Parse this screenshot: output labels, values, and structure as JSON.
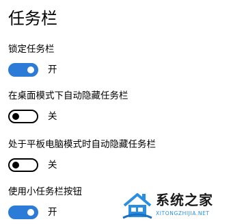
{
  "page": {
    "title": "任务栏"
  },
  "settings": [
    {
      "label": "锁定任务栏",
      "state": "on",
      "state_label": "开"
    },
    {
      "label": "在桌面模式下自动隐藏任务栏",
      "state": "off",
      "state_label": "关"
    },
    {
      "label": "处于平板电脑模式时自动隐藏任务栏",
      "state": "off",
      "state_label": "关"
    },
    {
      "label": "使用小任务栏按钮",
      "state": "on",
      "state_label": "开"
    }
  ],
  "watermark": {
    "title": "系统之家",
    "url": "XITONGZHIJIA.NET"
  },
  "colors": {
    "toggle_on": "#2c7bd6",
    "toggle_off_border": "#000000",
    "watermark_url": "#2a8fe0"
  }
}
